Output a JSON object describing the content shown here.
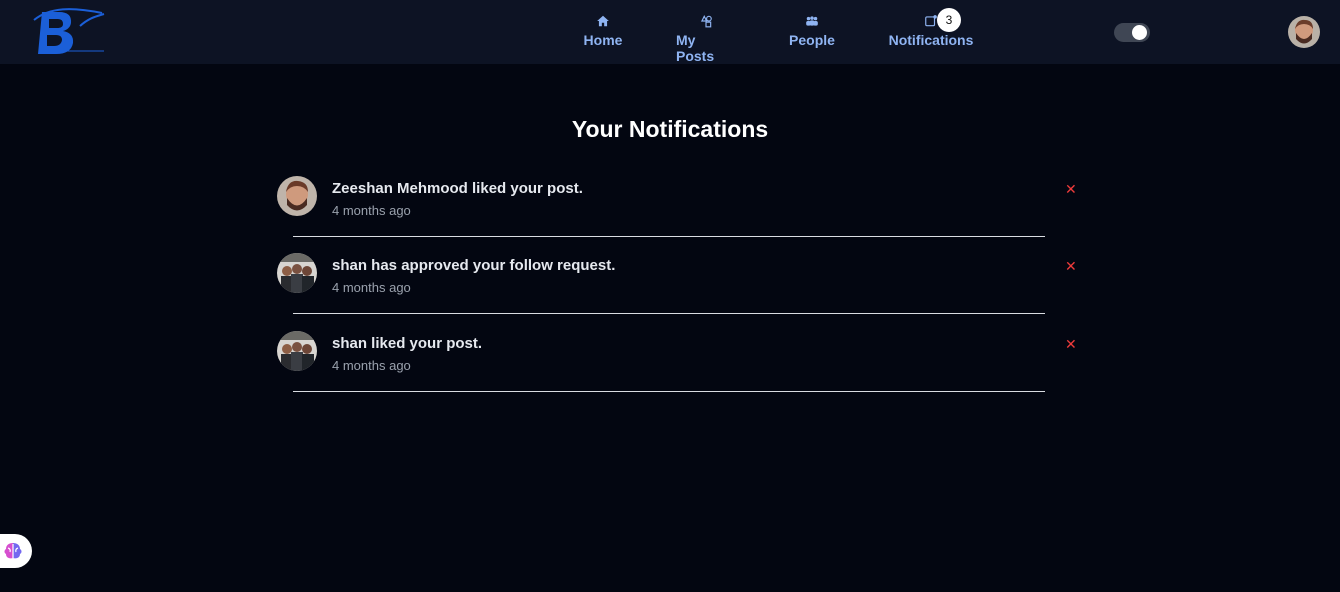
{
  "header": {
    "nav": [
      {
        "label": "Home",
        "icon": "home-icon"
      },
      {
        "label": "My Posts",
        "icon": "shapes-icon"
      },
      {
        "label": "People",
        "icon": "people-icon"
      },
      {
        "label": "Notifications",
        "icon": "notification-icon"
      }
    ],
    "notifications_count": "3",
    "brand_color": "#1b5fd8",
    "nav_color": "#8fb4f2"
  },
  "main": {
    "title": "Your Notifications",
    "notifications": [
      {
        "text": "Zeeshan Mehmood liked your post.",
        "time": "4 months ago"
      },
      {
        "text": "shan has approved your follow request.",
        "time": "4 months ago"
      },
      {
        "text": "shan liked your post.",
        "time": "4 months ago"
      }
    ]
  },
  "colors": {
    "background": "#030611",
    "topbar": "#0d1324",
    "close": "#ef3b3b"
  }
}
